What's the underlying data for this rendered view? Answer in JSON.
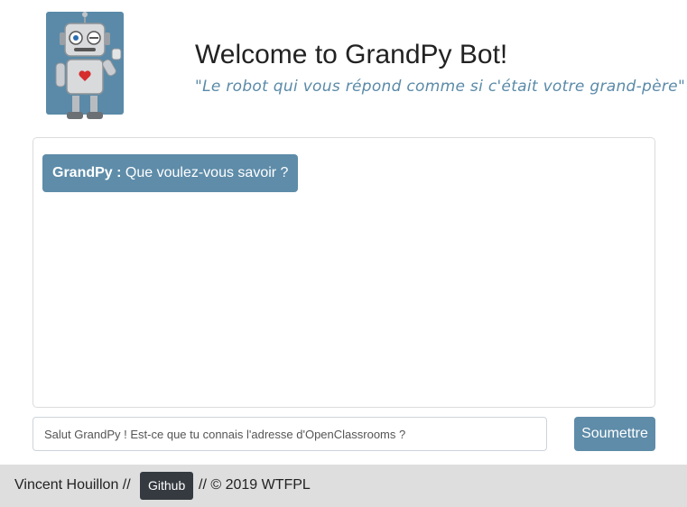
{
  "header": {
    "title": "Welcome to GrandPy Bot!",
    "tagline": "\"Le robot qui vous répond comme si c'était votre grand-père\""
  },
  "chat": {
    "messages": [
      {
        "sender": "GrandPy :",
        "text": " Que voulez-vous savoir ?"
      }
    ]
  },
  "form": {
    "input_value": "Salut GrandPy ! Est-ce que tu connais l'adresse d'OpenClassrooms ?",
    "submit_label": "Soumettre"
  },
  "footer": {
    "author": "Vincent Houillon //",
    "github_label": "Github",
    "copyright": "// © 2019 WTFPL"
  },
  "colors": {
    "accent": "#5e8ca9",
    "footer_bg": "#dedede",
    "github_bg": "#343a40"
  }
}
